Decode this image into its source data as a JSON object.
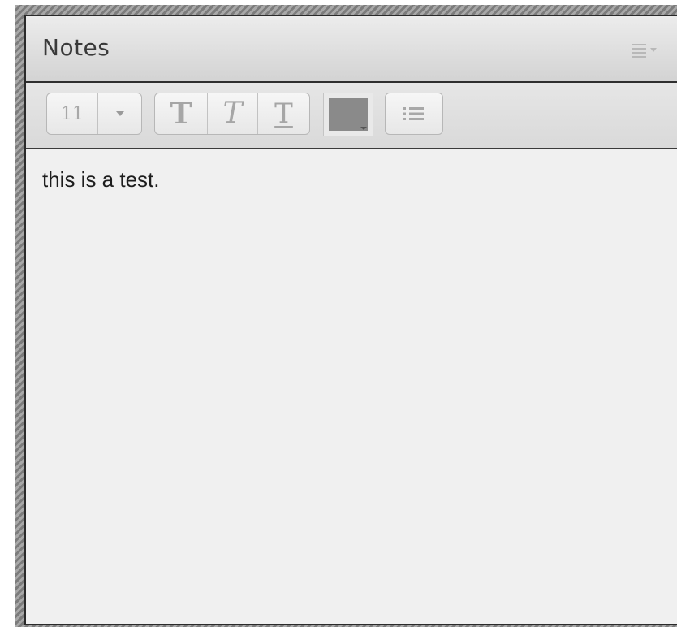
{
  "window": {
    "title": "Notes"
  },
  "header": {
    "menu_icon": "hamburger-menu-dropdown-icon"
  },
  "toolbar": {
    "font_size": "11",
    "font_size_dropdown_icon": "chevron-down-icon",
    "bold_label": "T",
    "italic_label": "T",
    "underline_label": "T",
    "text_color": "#8a8a8a",
    "list_icon": "bullet-list-icon"
  },
  "editor": {
    "content": "this is a test."
  },
  "colors": {
    "panel_background": "#f0f0f0",
    "frame_stripes": "#8f8f8f",
    "border": "#2a2a2a"
  }
}
